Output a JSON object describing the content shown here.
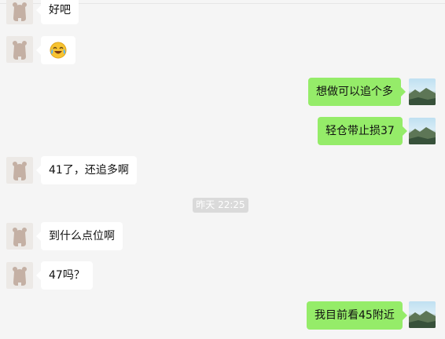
{
  "chat": {
    "messages": [
      {
        "side": "left",
        "text": "好吧"
      },
      {
        "side": "left",
        "type": "emoji",
        "emoji": "laughing-crying-emoji"
      },
      {
        "side": "right",
        "text": "想做可以追个多"
      },
      {
        "side": "right",
        "text": "轻仓带止损37"
      },
      {
        "side": "left",
        "text": "41了，还追多啊"
      },
      {
        "type": "timestamp",
        "text": "昨天 22:25"
      },
      {
        "side": "left",
        "text": "到什么点位啊"
      },
      {
        "side": "left",
        "text": "47吗？"
      },
      {
        "side": "right",
        "text": "我目前看45附近"
      }
    ]
  },
  "colors": {
    "background": "#f5f5f5",
    "self_bubble": "#95ec69",
    "other_bubble": "#ffffff",
    "timestamp_bg": "#dadada"
  }
}
